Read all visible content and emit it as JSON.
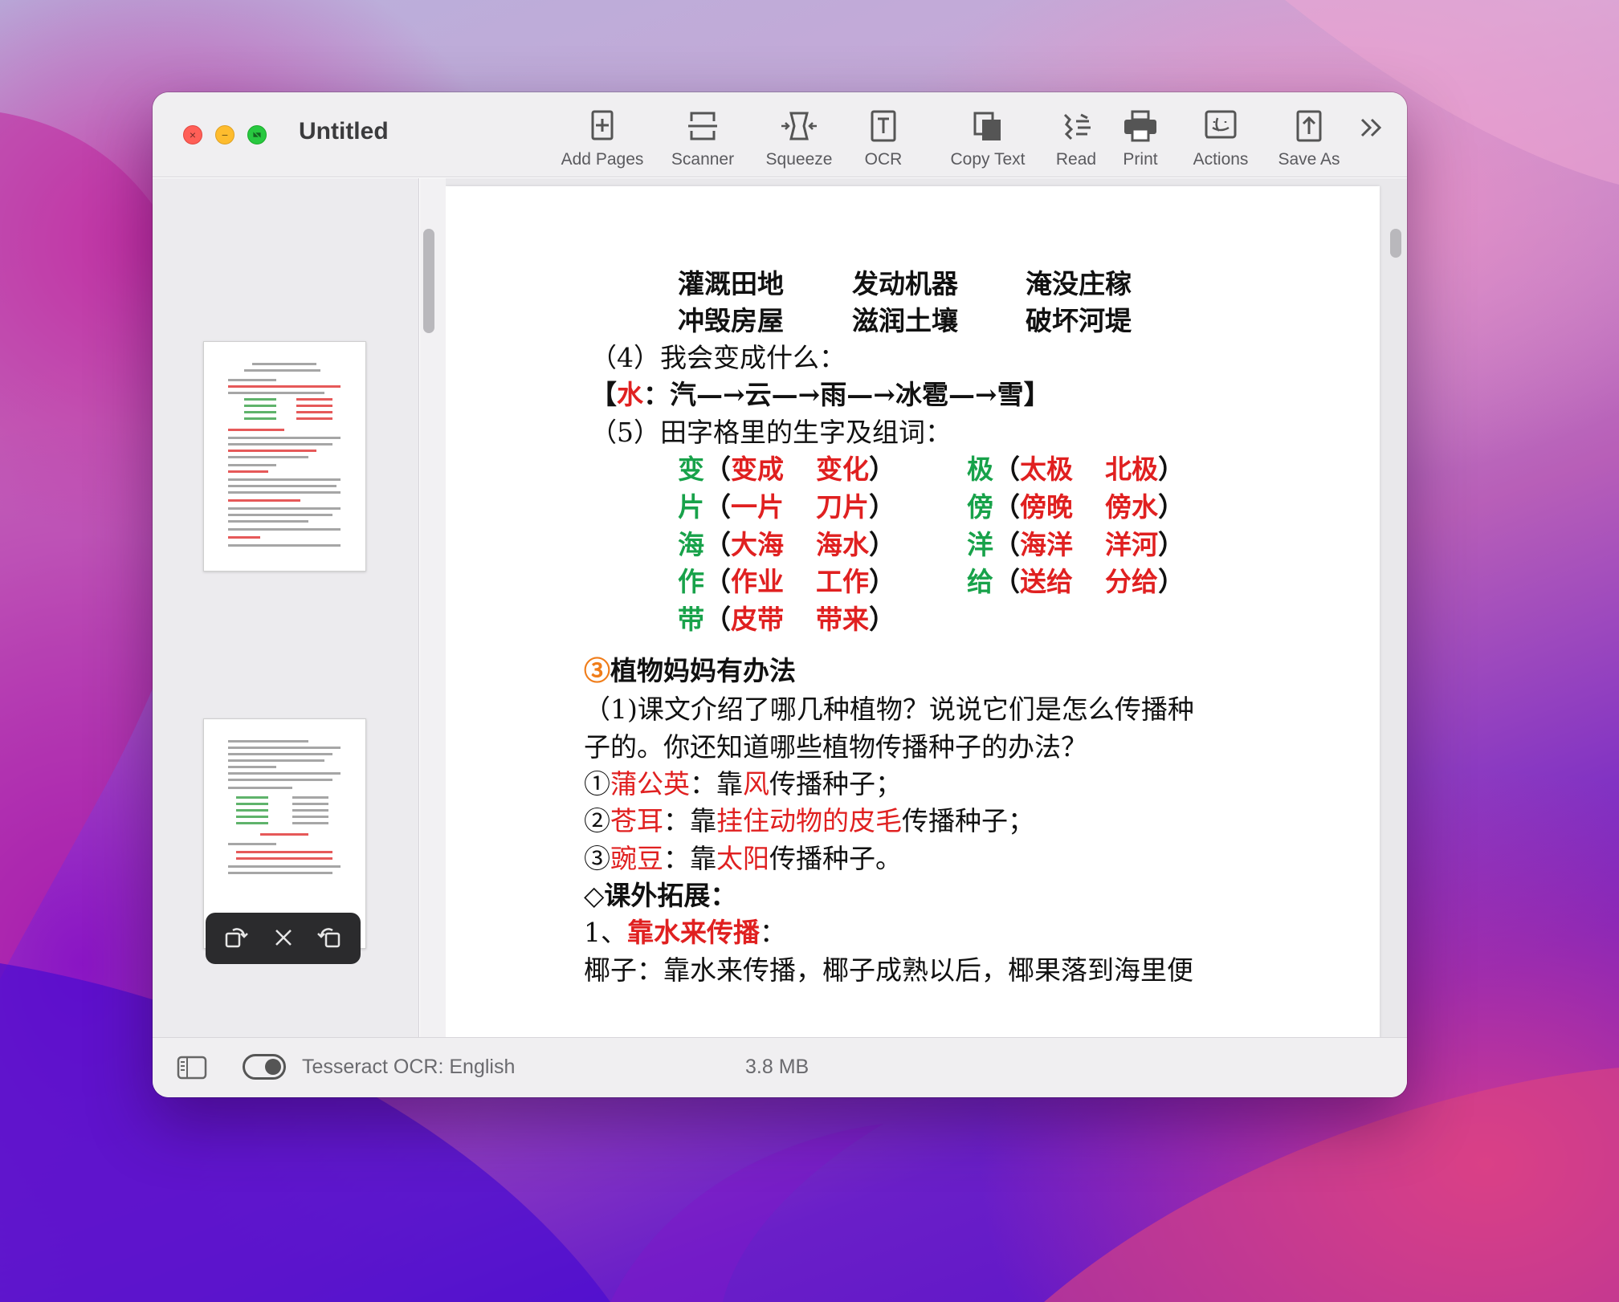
{
  "window": {
    "title": "Untitled"
  },
  "toolbar": {
    "add_pages": "Add Pages",
    "scanner": "Scanner",
    "squeeze": "Squeeze",
    "ocr": "OCR",
    "copy_text": "Copy Text",
    "read": "Read",
    "print": "Print",
    "actions": "Actions",
    "save_as": "Save As"
  },
  "statusbar": {
    "ocr_engine": "Tesseract OCR: English",
    "file_size": "3.8 MB"
  },
  "document": {
    "phrases_row1": [
      "灌溉田地",
      "发动机器",
      "淹没庄稼"
    ],
    "phrases_row2": [
      "冲毁房屋",
      "滋润土壤",
      "破坏河堤"
    ],
    "q4": "（4）我会变成什么：",
    "chain": {
      "open": "【",
      "subject": "水",
      "colon": "：",
      "steps": "汽—→云—→雨—→冰雹—→雪",
      "close": "】"
    },
    "q5": "（5）田字格里的生字及组词：",
    "vocab_left": [
      {
        "char": "变",
        "open": "（",
        "w1": "变成",
        "w2": "变化",
        "close": "）"
      },
      {
        "char": "片",
        "open": "（",
        "w1": "一片",
        "w2": "刀片",
        "close": "）"
      },
      {
        "char": "海",
        "open": "（",
        "w1": "大海",
        "w2": "海水",
        "close": "）"
      },
      {
        "char": "作",
        "open": "（",
        "w1": "作业",
        "w2": "工作",
        "close": "）"
      },
      {
        "char": "带",
        "open": "（",
        "w1": "皮带",
        "w2": "带来",
        "close": "）"
      }
    ],
    "vocab_right": [
      {
        "char": "极",
        "open": "（",
        "w1": "太极",
        "w2": "北极",
        "close": "）"
      },
      {
        "char": "傍",
        "open": "（",
        "w1": "傍晚",
        "w2": "傍水",
        "close": "）"
      },
      {
        "char": "洋",
        "open": "（",
        "w1": "海洋",
        "w2": "洋河",
        "close": "）"
      },
      {
        "char": "给",
        "open": "（",
        "w1": "送给",
        "w2": "分给",
        "close": "）"
      }
    ],
    "section3": {
      "marker": "③",
      "title": "植物妈妈有办法"
    },
    "p1_line1": "（1)课文介绍了哪几种植物？说说它们是怎么传播种",
    "p1_line2": "子的。你还知道哪些植物传播种子的办法？",
    "items": [
      {
        "n": "①",
        "name": "蒲公英",
        "mid": "：靠",
        "how": "风",
        "end": "传播种子；"
      },
      {
        "n": "②",
        "name": "苍耳",
        "mid": "：靠",
        "how": "挂住动物的皮毛",
        "end": "传播种子；"
      },
      {
        "n": "③",
        "name": "豌豆",
        "mid": "：靠",
        "how": "太阳",
        "end": "传播种子。"
      }
    ],
    "extension": "◇课外拓展：",
    "ext1": {
      "num": "1、",
      "text": "靠水来传播",
      "colon": "："
    },
    "coconut": "椰子：靠水来传播，椰子成熟以后，椰果落到海里便"
  },
  "colors": {
    "red": "#e02020",
    "green": "#18a24a",
    "orange": "#f07d1a",
    "close": "#ff5f57",
    "minimize": "#febc2e",
    "zoom": "#28c840"
  },
  "icons": [
    "close-icon",
    "minimize-icon",
    "zoom-icon",
    "add-pages-icon",
    "scanner-icon",
    "squeeze-icon",
    "ocr-icon",
    "copy-text-icon",
    "read-icon",
    "print-icon",
    "actions-icon",
    "save-as-icon",
    "overflow-chevron-icon",
    "rotate-left-icon",
    "delete-icon",
    "rotate-right-icon",
    "sidebar-toggle-icon",
    "ocr-toggle-switch"
  ]
}
